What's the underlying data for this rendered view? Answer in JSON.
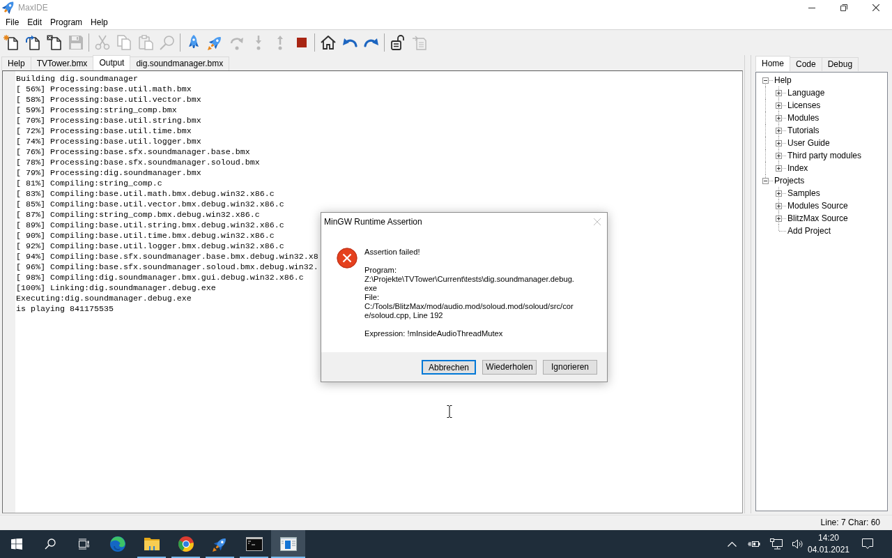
{
  "window": {
    "title": "MaxIDE"
  },
  "menu": [
    "File",
    "Edit",
    "Program",
    "Help"
  ],
  "toolbar": [
    [
      {
        "kind": "new",
        "disabled": false
      },
      {
        "kind": "open",
        "disabled": false
      },
      {
        "kind": "close",
        "disabled": false
      },
      {
        "kind": "save",
        "disabled": true
      }
    ],
    [
      {
        "kind": "cut",
        "disabled": true
      },
      {
        "kind": "copy",
        "disabled": true
      },
      {
        "kind": "paste",
        "disabled": true
      },
      {
        "kind": "find",
        "disabled": true
      }
    ],
    [
      {
        "kind": "build",
        "disabled": false
      },
      {
        "kind": "build_run",
        "disabled": false
      },
      {
        "kind": "step",
        "disabled": true
      },
      {
        "kind": "step_in",
        "disabled": true
      },
      {
        "kind": "step_out",
        "disabled": true
      },
      {
        "kind": "stop",
        "disabled": false
      }
    ],
    [
      {
        "kind": "home",
        "disabled": false
      },
      {
        "kind": "back",
        "disabled": false
      },
      {
        "kind": "forward",
        "disabled": false
      }
    ],
    [
      {
        "kind": "lock",
        "disabled": false
      },
      {
        "kind": "unlock",
        "disabled": true
      }
    ]
  ],
  "editor_tabs": [
    {
      "label": "Help",
      "selected": false
    },
    {
      "label": "TVTower.bmx",
      "selected": false
    },
    {
      "label": "Output",
      "selected": true
    },
    {
      "label": "dig.soundmanager.bmx",
      "selected": false
    }
  ],
  "output": {
    "lines": [
      "Building dig.soundmanager",
      "[ 56%] Processing:base.util.math.bmx",
      "[ 58%] Processing:base.util.vector.bmx",
      "[ 59%] Processing:string_comp.bmx",
      "[ 70%] Processing:base.util.string.bmx",
      "[ 72%] Processing:base.util.time.bmx",
      "[ 74%] Processing:base.util.logger.bmx",
      "[ 76%] Processing:base.sfx.soundmanager.base.bmx",
      "[ 78%] Processing:base.sfx.soundmanager.soloud.bmx",
      "[ 79%] Processing:dig.soundmanager.bmx",
      "[ 81%] Compiling:string_comp.c",
      "[ 83%] Compiling:base.util.math.bmx.debug.win32.x86.c",
      "[ 85%] Compiling:base.util.vector.bmx.debug.win32.x86.c",
      "[ 87%] Compiling:string_comp.bmx.debug.win32.x86.c",
      "[ 89%] Compiling:base.util.string.bmx.debug.win32.x86.c",
      "[ 90%] Compiling:base.util.time.bmx.debug.win32.x86.c",
      "[ 92%] Compiling:base.util.logger.bmx.debug.win32.x86.c",
      "[ 94%] Compiling:base.sfx.soundmanager.base.bmx.debug.win32.x8",
      "[ 96%] Compiling:base.sfx.soundmanager.soloud.bmx.debug.win32.",
      "[ 98%] Compiling:dig.soundmanager.bmx.gui.debug.win32.x86.c",
      "[100%] Linking:dig.soundmanager.debug.exe",
      "Executing:dig.soundmanager.debug.exe",
      "is playing 841175535"
    ]
  },
  "side_tabs": [
    {
      "label": "Home",
      "selected": true
    },
    {
      "label": "Code",
      "selected": false
    },
    {
      "label": "Debug",
      "selected": false
    }
  ],
  "tree": [
    {
      "label": "Help",
      "expanded": true,
      "children": [
        {
          "label": "Language",
          "expanded": false
        },
        {
          "label": "Licenses",
          "expanded": false
        },
        {
          "label": "Modules",
          "expanded": false
        },
        {
          "label": "Tutorials",
          "expanded": false
        },
        {
          "label": "User Guide",
          "expanded": false
        },
        {
          "label": "Third party modules",
          "expanded": false
        },
        {
          "label": "Index",
          "expanded": false
        }
      ]
    },
    {
      "label": "Projects",
      "expanded": true,
      "children": [
        {
          "label": "Samples",
          "expanded": false
        },
        {
          "label": "Modules Source",
          "expanded": false
        },
        {
          "label": "BlitzMax Source",
          "expanded": false
        },
        {
          "label": "Add Project"
        }
      ]
    }
  ],
  "status_bar": {
    "position": "Line: 7 Char: 60"
  },
  "dialog": {
    "title": "MinGW Runtime Assertion",
    "paragraphs": [
      "Assertion failed!",
      "Program:\nZ:\\Projekte\\TVTower\\Current\\tests\\dig.soundmanager.debug.\nexe\nFile:\nC:/Tools/BlitzMax/mod/audio.mod/soloud.mod/soloud/src/cor\ne/soloud.cpp, Line 192",
      "Expression: !mInsideAudioThreadMutex"
    ],
    "buttons": [
      {
        "label": "Abbrechen",
        "focused": true
      },
      {
        "label": "Wiederholen",
        "focused": false
      },
      {
        "label": "Ignorieren",
        "focused": false
      }
    ]
  },
  "taskbar": {
    "apps": [
      {
        "kind": "swirl",
        "running": false,
        "selected": false
      },
      {
        "kind": "folder",
        "running": true,
        "selected": false
      },
      {
        "kind": "ring",
        "running": true,
        "selected": false
      },
      {
        "kind": "rocket",
        "running": true,
        "selected": false
      },
      {
        "kind": "terminal",
        "running": true,
        "selected": false
      },
      {
        "kind": "window",
        "running": true,
        "selected": true
      }
    ],
    "clock": {
      "time": "14:20",
      "date": "04.01.2021"
    }
  }
}
